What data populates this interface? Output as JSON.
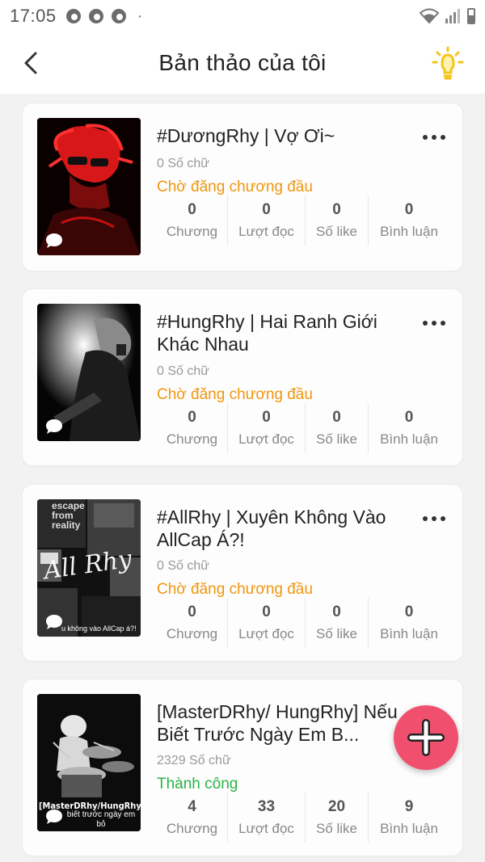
{
  "status_bar": {
    "time": "17:05",
    "dot": "·"
  },
  "header": {
    "title": "Bản thảo của tôi",
    "back_icon": "chevron-left-icon",
    "tip_icon": "lightbulb-icon"
  },
  "stat_labels": {
    "chapters": "Chương",
    "reads": "Lượt đọc",
    "likes": "Số like",
    "comments": "Bình luận"
  },
  "stories": [
    {
      "title": "#DươngRhy | Vợ Ơi~",
      "word_count": "0 Số chữ",
      "status": "Chờ đăng chương đầu",
      "chapters": "0",
      "reads": "0",
      "likes": "0",
      "comments": "0"
    },
    {
      "title": "#HungRhy | Hai Ranh Giới Khác Nhau",
      "word_count": "0 Số chữ",
      "status": "Chờ đăng chương đầu",
      "chapters": "0",
      "reads": "0",
      "likes": "0",
      "comments": "0"
    },
    {
      "title": "#AllRhy | Xuyên Không Vào AllCap Á?!",
      "word_count": "0 Số chữ",
      "status": "Chờ đăng chương đầu",
      "chapters": "0",
      "reads": "0",
      "likes": "0",
      "comments": "0",
      "cover_text": {
        "escape": "escape from reality",
        "script": "All Rhy",
        "caption": "u không vào AllCap á?!"
      }
    },
    {
      "title": "[MasterDRhy/ HungRhy] Nếu Biết Trước Ngày Em B...",
      "word_count": "2329 Số chữ",
      "status": "Thành công",
      "chapters": "4",
      "reads": "33",
      "likes": "20",
      "comments": "9",
      "cover_text": {
        "banner": "[MasterDRhy/HungRhy]",
        "caption": "biết trước ngày em bỏ"
      }
    }
  ],
  "fab": {
    "icon": "plus-icon"
  },
  "colors": {
    "pending": "#f0960e",
    "success": "#28b446",
    "fab": "#f0506e",
    "bulb": "#f5c518"
  }
}
